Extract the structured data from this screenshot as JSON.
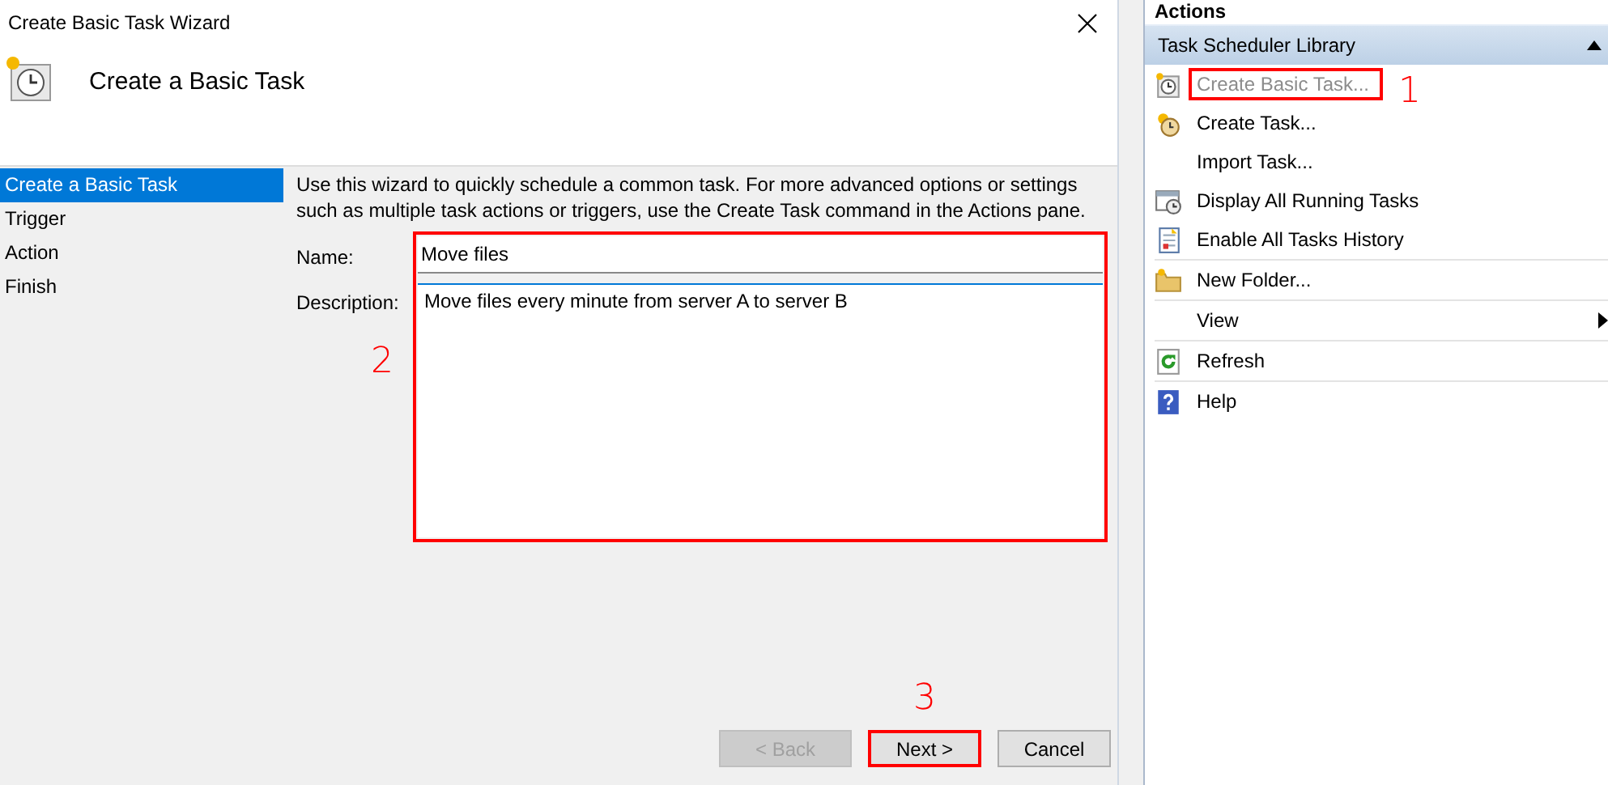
{
  "dialog": {
    "title": "Create Basic Task Wizard",
    "heading": "Create a Basic Task",
    "steps": [
      {
        "label": "Create a Basic Task",
        "selected": true
      },
      {
        "label": "Trigger",
        "selected": false
      },
      {
        "label": "Action",
        "selected": false
      },
      {
        "label": "Finish",
        "selected": false
      }
    ],
    "intro": "Use this wizard to quickly schedule a common task.  For more advanced options or settings such as multiple task actions or triggers, use the Create Task command in the Actions pane.",
    "name_label": "Name:",
    "name_value": "Move files",
    "description_label": "Description:",
    "description_value": "Move files every minute from server A to server B",
    "fields_annotation": "2",
    "buttons": [
      {
        "label": "< Back",
        "disabled": true
      },
      {
        "label": "Next >",
        "disabled": false,
        "annotation": "3"
      },
      {
        "label": "Cancel",
        "disabled": false
      }
    ]
  },
  "actions": {
    "header": "Actions",
    "section": {
      "title": "Task Scheduler Library",
      "expanded": true
    },
    "groups": [
      {
        "items": [
          {
            "label": "Create Basic Task...",
            "kind": "clock",
            "disabled": true,
            "annotation": "1",
            "submenu": false
          },
          {
            "label": "Create Task...",
            "kind": "clock-star",
            "disabled": false,
            "submenu": false
          },
          {
            "label": "Import Task...",
            "disabled": false,
            "submenu": false
          },
          {
            "label": "Display All Running Tasks",
            "kind": "window-clock",
            "disabled": false,
            "submenu": false
          },
          {
            "label": "Enable All Tasks History",
            "kind": "notes",
            "disabled": false,
            "submenu": false
          }
        ]
      },
      {
        "items": [
          {
            "label": "New Folder...",
            "kind": "folder",
            "disabled": false,
            "submenu": false
          }
        ]
      },
      {
        "items": [
          {
            "label": "View",
            "disabled": false,
            "submenu": true
          }
        ]
      },
      {
        "items": [
          {
            "label": "Refresh",
            "kind": "refresh",
            "disabled": false,
            "submenu": false
          }
        ]
      },
      {
        "items": [
          {
            "label": "Help",
            "kind": "help",
            "disabled": false,
            "submenu": false
          }
        ]
      }
    ]
  }
}
